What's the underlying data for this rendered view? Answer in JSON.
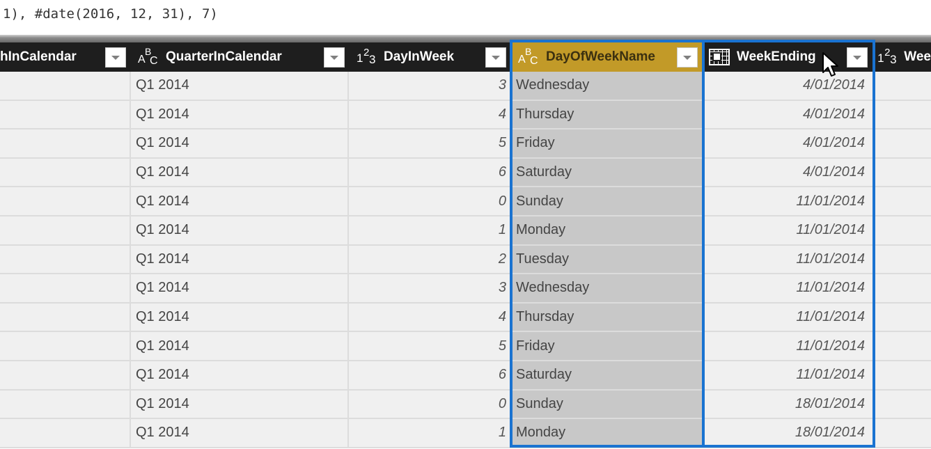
{
  "formula_bar": {
    "text": "1), #date(2016, 12, 31), 7)"
  },
  "columns": [
    {
      "name": "hInCalendar",
      "type": "none",
      "type_icon": "",
      "selected": false
    },
    {
      "name": "QuarterInCalendar",
      "type": "text",
      "type_icon": "abc-text-icon",
      "selected": false
    },
    {
      "name": "DayInWeek",
      "type": "whole-number",
      "type_icon": "123-number-icon",
      "selected": false
    },
    {
      "name": "DayOfWeekName",
      "type": "text",
      "type_icon": "abc-text-icon",
      "selected": true
    },
    {
      "name": "WeekEnding",
      "type": "date",
      "type_icon": "calendar-date-icon",
      "selected": false
    },
    {
      "name": "Wee",
      "type": "whole-number",
      "type_icon": "123-number-icon",
      "selected": false
    }
  ],
  "type_glyphs": {
    "abc": {
      "a": "A",
      "b": "B",
      "c": "C"
    },
    "n123": {
      "one": "1",
      "two": "2",
      "three": "3"
    }
  },
  "rows": [
    {
      "quarter": "Q1 2014",
      "day": "3",
      "dayname": "Wednesday",
      "week": "4/01/2014"
    },
    {
      "quarter": "Q1 2014",
      "day": "4",
      "dayname": "Thursday",
      "week": "4/01/2014"
    },
    {
      "quarter": "Q1 2014",
      "day": "5",
      "dayname": "Friday",
      "week": "4/01/2014"
    },
    {
      "quarter": "Q1 2014",
      "day": "6",
      "dayname": "Saturday",
      "week": "4/01/2014"
    },
    {
      "quarter": "Q1 2014",
      "day": "0",
      "dayname": "Sunday",
      "week": "11/01/2014"
    },
    {
      "quarter": "Q1 2014",
      "day": "1",
      "dayname": "Monday",
      "week": "11/01/2014"
    },
    {
      "quarter": "Q1 2014",
      "day": "2",
      "dayname": "Tuesday",
      "week": "11/01/2014"
    },
    {
      "quarter": "Q1 2014",
      "day": "3",
      "dayname": "Wednesday",
      "week": "11/01/2014"
    },
    {
      "quarter": "Q1 2014",
      "day": "4",
      "dayname": "Thursday",
      "week": "11/01/2014"
    },
    {
      "quarter": "Q1 2014",
      "day": "5",
      "dayname": "Friday",
      "week": "11/01/2014"
    },
    {
      "quarter": "Q1 2014",
      "day": "6",
      "dayname": "Saturday",
      "week": "11/01/2014"
    },
    {
      "quarter": "Q1 2014",
      "day": "0",
      "dayname": "Sunday",
      "week": "18/01/2014"
    },
    {
      "quarter": "Q1 2014",
      "day": "1",
      "dayname": "Monday",
      "week": "18/01/2014"
    }
  ],
  "colors": {
    "header_bg": "#1e1e1e",
    "selected_header_bg": "#c29a28",
    "selected_column_bg": "#c8c8c8",
    "selection_outline": "#1a73d1",
    "cell_bg": "#f0f0f0"
  }
}
